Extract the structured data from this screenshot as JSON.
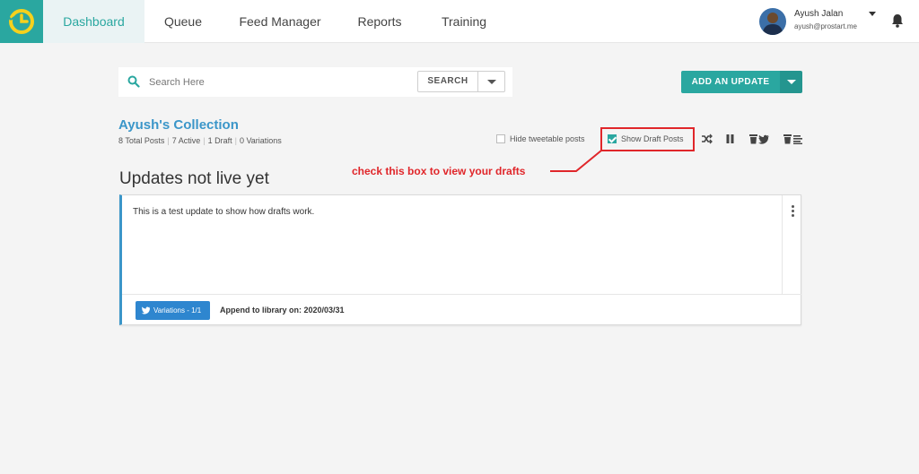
{
  "nav": {
    "items": [
      {
        "label": "Dashboard",
        "active": true
      },
      {
        "label": "Queue",
        "active": false
      },
      {
        "label": "Feed Manager",
        "active": false
      },
      {
        "label": "Reports",
        "active": false
      },
      {
        "label": "Training",
        "active": false
      }
    ],
    "user": {
      "name": "Ayush Jalan",
      "email": "ayush@prostart.me"
    },
    "icons": {
      "logo": "clock-logo-icon",
      "notifications": "bell-icon",
      "menu_caret": "caret-down-icon"
    }
  },
  "search": {
    "placeholder": "Search Here",
    "button_label": "SEARCH"
  },
  "add_update": {
    "label": "ADD AN UPDATE"
  },
  "collection": {
    "title": "Ayush's Collection",
    "stats": [
      "8 Total Posts",
      "7 Active",
      "1 Draft",
      "0 Variations"
    ],
    "hide_tweetable_label": "Hide tweetable posts",
    "hide_tweetable_checked": false,
    "show_draft_label": "Show Draft Posts",
    "show_draft_checked": true,
    "toolbar_icons": [
      "shuffle-icon",
      "pause-icon",
      "delete-tweets-icon",
      "delete-list-icon"
    ]
  },
  "annotation": {
    "text": "check this box to view your drafts",
    "color": "#e0262a"
  },
  "section": {
    "title": "Updates not live yet"
  },
  "update": {
    "text": "This is a test update to show how drafts work.",
    "variations_label": "Variations - 1/1",
    "append_text": "Append to library on: 2020/03/31"
  },
  "colors": {
    "accent": "#2aa7a0",
    "link": "#3b96c9",
    "twitter": "#2e86cf",
    "highlight": "#e0262a"
  }
}
